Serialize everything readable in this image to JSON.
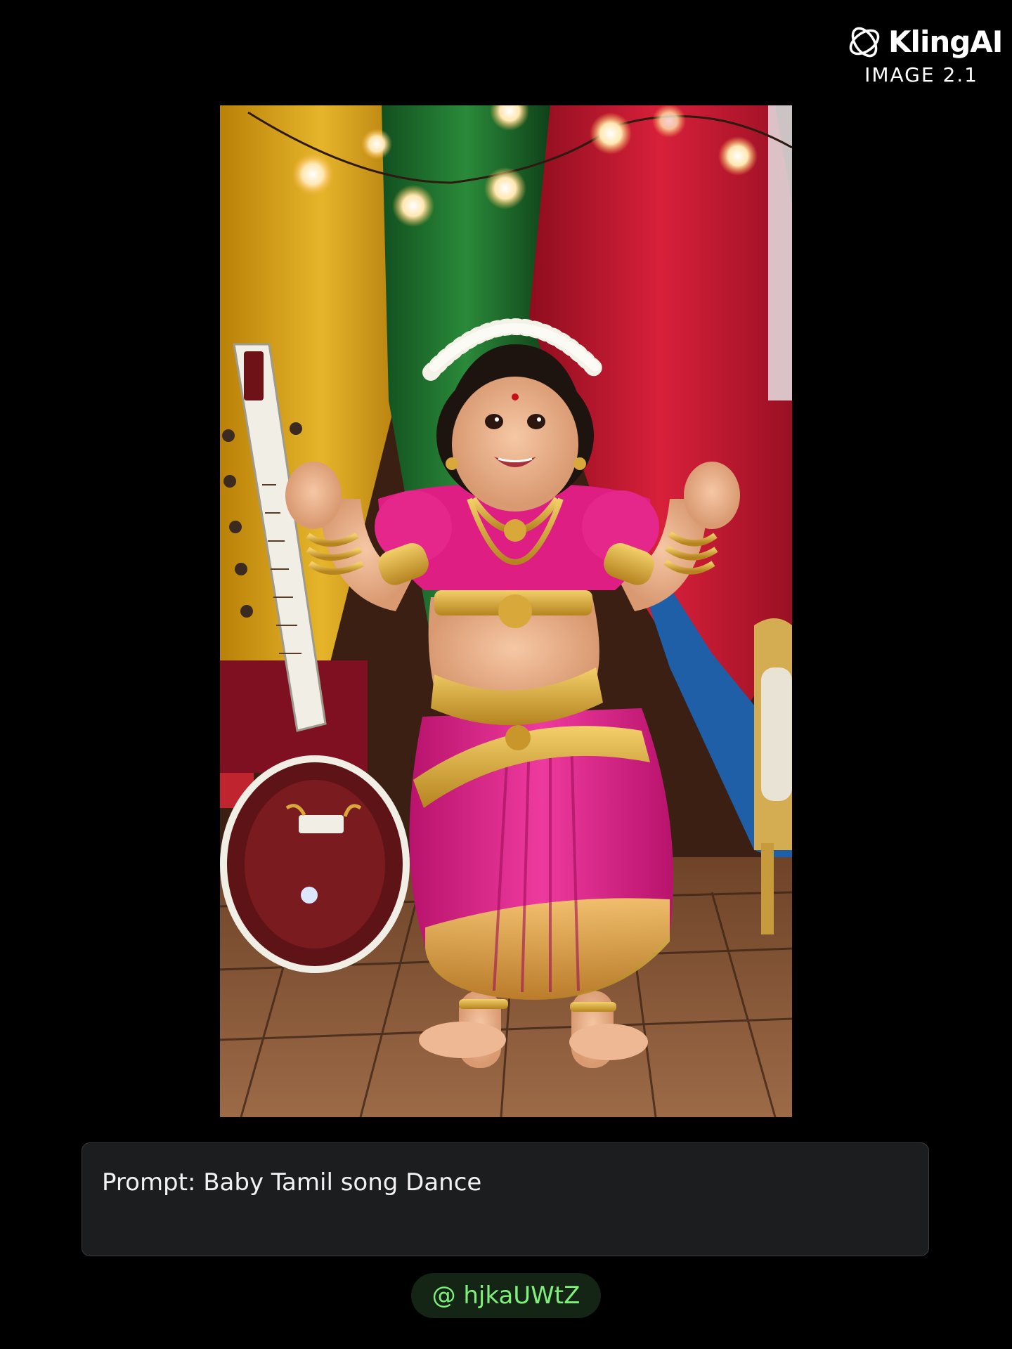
{
  "brand": {
    "name": "KlingAI",
    "version": "IMAGE 2.1",
    "logo_icon": "kling-swirl-icon"
  },
  "image": {
    "alt": "Baby Tamil song Dance",
    "colors": {
      "curtain_yellow": "#d9a514",
      "curtain_green": "#1e6e2c",
      "curtain_red": "#c4162c",
      "curtain_blue": "#1f5fa8",
      "costume_pink": "#e0218a",
      "gold": "#d9a83a",
      "floor": "#8a5a3a"
    }
  },
  "prompt": {
    "text": "Prompt: Baby Tamil song Dance"
  },
  "author": {
    "handle": "@ hjkaUWtZ",
    "accent": "#7ff07a"
  }
}
